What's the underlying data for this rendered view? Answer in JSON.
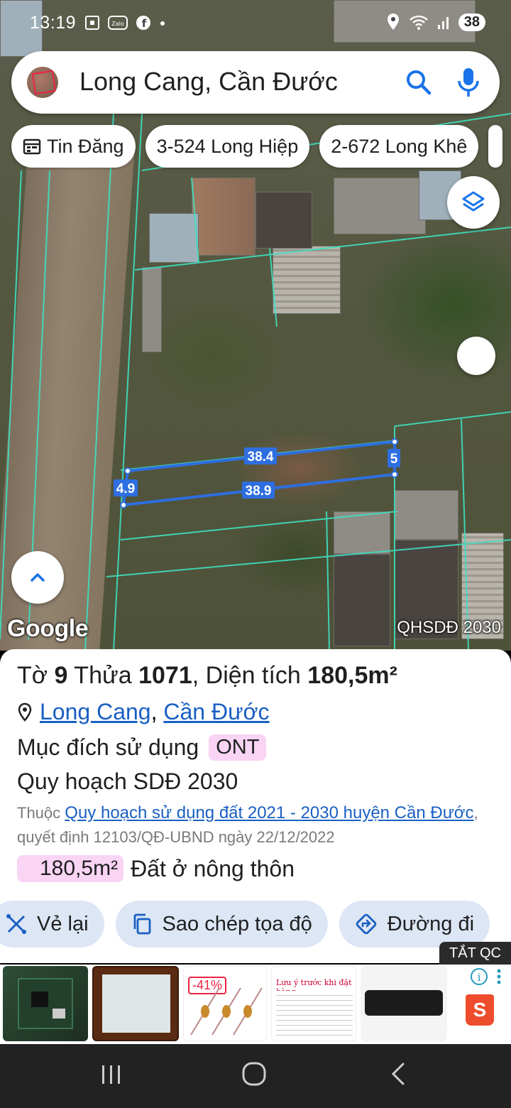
{
  "status_bar": {
    "time": "13:19",
    "notif_icons": [
      "screenshot-icon",
      "zalo-icon",
      "facebook-icon",
      "dot-icon"
    ],
    "battery": "38"
  },
  "search": {
    "value": "Long Cang, Cần Đước"
  },
  "chips": [
    {
      "label": "Tin Đăng",
      "icon": "calendar-icon"
    },
    {
      "label": "3-524 Long Hiệp"
    },
    {
      "label": "2-672 Long Khê"
    }
  ],
  "map": {
    "measurements": {
      "top": "38.4",
      "bottom": "38.9",
      "left": "4.9",
      "right": "5"
    },
    "logo": "Google",
    "layer_label": "QHSDĐ 2030"
  },
  "parcel": {
    "prefix_to": "Tờ",
    "to": "9",
    "prefix_thua": "Thửa",
    "thua": "1071",
    "prefix_area": ", Diện tích",
    "area": "180,5m²",
    "location_1": "Long Cang",
    "location_sep": ",",
    "location_2": "Cần Đước",
    "purpose_label": "Mục đích sử dụng",
    "purpose_code": "ONT",
    "plan_title": "Quy hoạch SDĐ 2030",
    "belongs_prefix": "Thuộc",
    "plan_link": "Quy hoạch sử dụng đất 2021 - 2030 huyện Cần Đước",
    "plan_link_suffix": ",",
    "decision": "quyết định 12103/QĐ-UBND ngày 22/12/2022",
    "legend_area": "180,5m²",
    "legend_type": "Đất ở nông thôn"
  },
  "actions": [
    {
      "label": "Vẻ lại",
      "icon": "redraw-icon"
    },
    {
      "label": "Sao chép tọa độ",
      "icon": "copy-icon"
    },
    {
      "label": "Đường đi",
      "icon": "directions-icon"
    }
  ],
  "ad": {
    "close_label": "TẮT QC",
    "discount": "-41%",
    "notice_title": "Lưu ý trước khi đặt hàng",
    "shop": "S"
  },
  "colors": {
    "accent": "#1a5fc2",
    "parcel_line": "#2e6ee0",
    "boundary": "#3fe0c0",
    "badge": "#f9d4f4"
  }
}
